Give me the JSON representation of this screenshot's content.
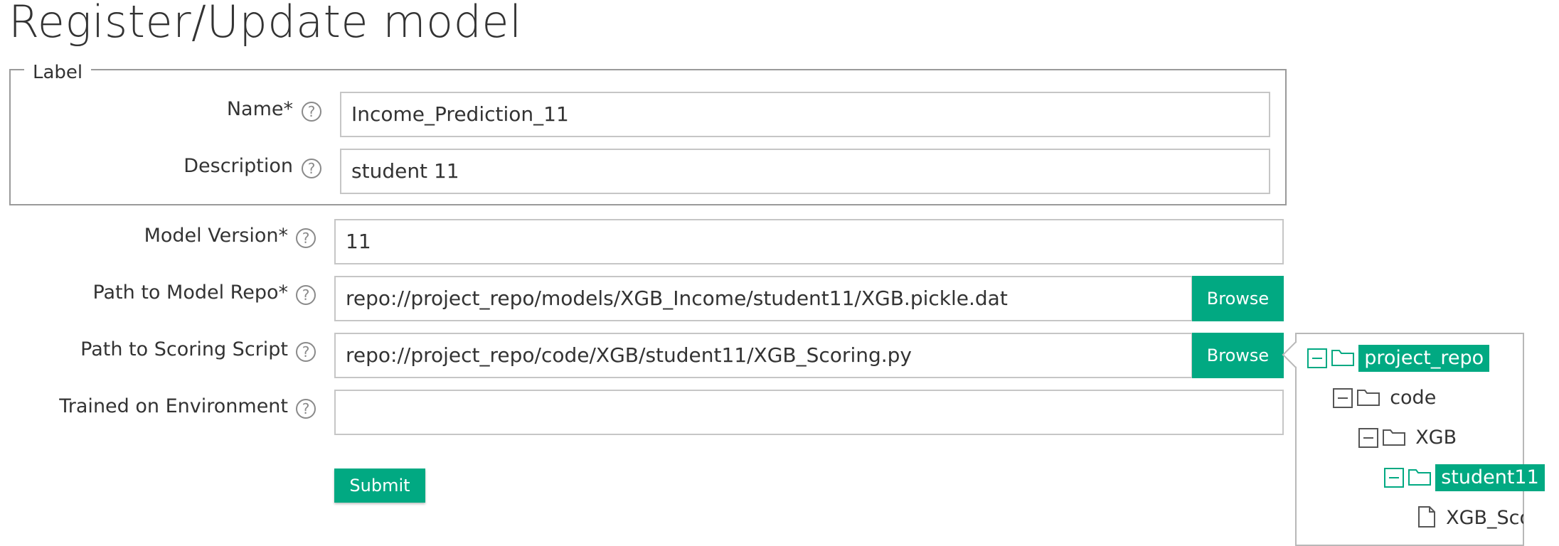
{
  "page": {
    "title": "Register/Update model"
  },
  "label_section": {
    "legend": "Label",
    "name": {
      "label": "Name*",
      "value": "Income_Prediction_11"
    },
    "description": {
      "label": "Description",
      "value": "student 11"
    }
  },
  "model_version": {
    "label": "Model Version*",
    "value": "11"
  },
  "model_repo": {
    "label": "Path to Model Repo*",
    "value": "repo://project_repo/models/XGB_Income/student11/XGB.pickle.dat",
    "browse_label": "Browse"
  },
  "scoring_script": {
    "label": "Path to Scoring Script",
    "value": "repo://project_repo/code/XGB/student11/XGB_Scoring.py",
    "browse_label": "Browse"
  },
  "environment": {
    "label": "Trained on Environment",
    "value": ""
  },
  "submit_label": "Submit",
  "help_icon": "question-icon",
  "file_tree": {
    "nodes": [
      {
        "label": "project_repo",
        "type": "folder",
        "selected": true
      },
      {
        "label": "code",
        "type": "folder",
        "selected": false
      },
      {
        "label": "XGB",
        "type": "folder",
        "selected": false
      },
      {
        "label": "student11",
        "type": "folder",
        "selected": true
      },
      {
        "label": "XGB_Scoring.py",
        "type": "file",
        "selected": false
      }
    ]
  },
  "colors": {
    "accent": "#01a982",
    "text": "#333333",
    "border": "#c6c6c6"
  }
}
